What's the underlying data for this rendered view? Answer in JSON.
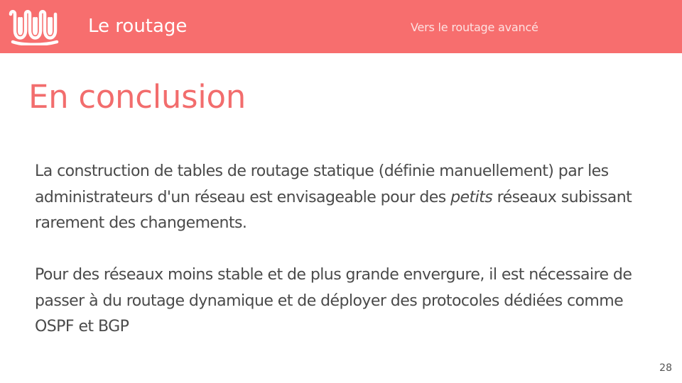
{
  "header": {
    "section_title": "Le routage",
    "breadcrumb": "Vers le routage avancé"
  },
  "slide": {
    "title": "En conclusion",
    "paragraph1": {
      "before_em": "La construction de tables de routage statique (définie manuellement) par les administrateurs d'un réseau est envisageable pour des ",
      "em": "petits",
      "after_em": " réseaux subissant rarement des changements."
    },
    "paragraph2": "Pour des réseaux moins stable et de plus grande envergure, il est nécessaire de passer à du routage dynamique et de déployer des protocoles dédiées comme OSPF et BGP",
    "page_number": "28"
  },
  "colors": {
    "header_background": "#f76e6e",
    "title_color": "#f26d6d",
    "body_text": "#4a4a4a"
  },
  "icons": {
    "logo": "wave-logo-icon"
  }
}
